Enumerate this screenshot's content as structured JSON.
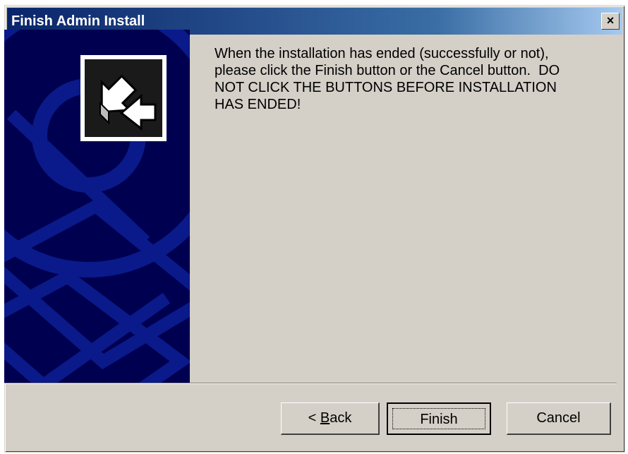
{
  "window": {
    "title": "Finish Admin Install",
    "close_label": "×"
  },
  "banner": {
    "icon": "install-arrows-icon"
  },
  "message": "When the installation has ended (successfully or not),\nplease click the Finish button or the Cancel button.  DO\nNOT CLICK THE BUTTONS BEFORE INSTALLATION\nHAS ENDED!",
  "buttons": {
    "back_prefix": "< ",
    "back_accel": "B",
    "back_rest": "ack",
    "finish_label": "Finish",
    "cancel_label": "Cancel"
  },
  "colors": {
    "titlebar_start": "#0a246a",
    "titlebar_end": "#a6caf0",
    "banner_bg": "#000050",
    "banner_pattern": "#0a1a8a",
    "dialog_bg": "#d4d0c8"
  }
}
